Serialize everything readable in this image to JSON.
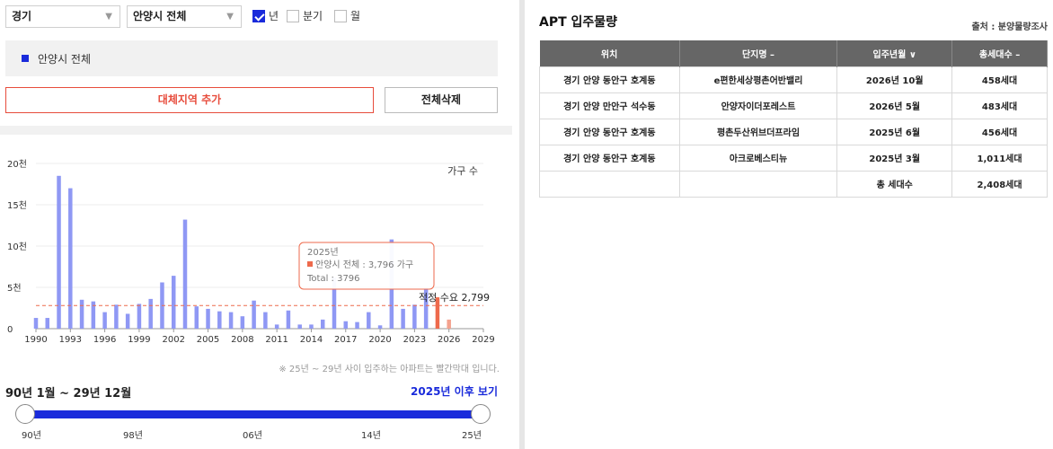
{
  "filters": {
    "province": "경기",
    "city": "안양시 전체",
    "dropdown_arrow": "▼",
    "period_options": [
      {
        "label": "년",
        "checked": true
      },
      {
        "label": "분기",
        "checked": false
      },
      {
        "label": "월",
        "checked": false
      }
    ]
  },
  "selected_region": "안양시 전체",
  "buttons": {
    "add_region": "대체지역 추가",
    "delete_all": "전체삭제"
  },
  "chart_data": {
    "type": "bar",
    "unit_label": "가구 수",
    "y_ticks": [
      "0",
      "5천",
      "10천",
      "15천",
      "20천"
    ],
    "ylim": [
      0,
      20000
    ],
    "x_ticks": [
      "1990",
      "1993",
      "1996",
      "1999",
      "2002",
      "2005",
      "2008",
      "2011",
      "2014",
      "2017",
      "2020",
      "2023",
      "2026",
      "2029"
    ],
    "x_range": [
      1990,
      2029
    ],
    "series": [
      {
        "color_past": "#8f98f4",
        "color_future": "#f4a28e",
        "color_highlight": "#ee6a4c",
        "points": [
          {
            "year": 1990,
            "value": 1300
          },
          {
            "year": 1991,
            "value": 1300
          },
          {
            "year": 1992,
            "value": 18500
          },
          {
            "year": 1993,
            "value": 17000
          },
          {
            "year": 1994,
            "value": 3500
          },
          {
            "year": 1995,
            "value": 3300
          },
          {
            "year": 1996,
            "value": 2000
          },
          {
            "year": 1997,
            "value": 2900
          },
          {
            "year": 1998,
            "value": 1800
          },
          {
            "year": 1999,
            "value": 3000
          },
          {
            "year": 2000,
            "value": 3600
          },
          {
            "year": 2001,
            "value": 5600
          },
          {
            "year": 2002,
            "value": 6400
          },
          {
            "year": 2003,
            "value": 13200
          },
          {
            "year": 2004,
            "value": 2700
          },
          {
            "year": 2005,
            "value": 2400
          },
          {
            "year": 2006,
            "value": 2100
          },
          {
            "year": 2007,
            "value": 2000
          },
          {
            "year": 2008,
            "value": 1500
          },
          {
            "year": 2009,
            "value": 3400
          },
          {
            "year": 2010,
            "value": 2000
          },
          {
            "year": 2011,
            "value": 500
          },
          {
            "year": 2012,
            "value": 2200
          },
          {
            "year": 2013,
            "value": 500
          },
          {
            "year": 2014,
            "value": 500
          },
          {
            "year": 2015,
            "value": 1100
          },
          {
            "year": 2016,
            "value": 6200
          },
          {
            "year": 2017,
            "value": 900
          },
          {
            "year": 2018,
            "value": 800
          },
          {
            "year": 2019,
            "value": 2000
          },
          {
            "year": 2020,
            "value": 400
          },
          {
            "year": 2021,
            "value": 10800
          },
          {
            "year": 2022,
            "value": 2400
          },
          {
            "year": 2023,
            "value": 2900
          },
          {
            "year": 2024,
            "value": 5000
          },
          {
            "year": 2025,
            "value": 3796
          },
          {
            "year": 2026,
            "value": 1100
          }
        ]
      }
    ],
    "reference_line": {
      "label": "적정 수요 2,799",
      "value": 2799,
      "color": "#ee6a4c"
    },
    "tooltip": {
      "year_label": "2025년",
      "series_line": "안양시 전체 : 3,796 가구",
      "total_line": "Total : 3796",
      "year": 2025
    }
  },
  "chart_note": "※ 25년 ~ 29년 사이 입주하는 아파트는 빨간막대 입니다.",
  "period_label": "90년 1월 ~ 29년 12월",
  "show_after_2025": "2025년 이후 보기",
  "slider": {
    "tick_labels": [
      "90년",
      "98년",
      "06년",
      "14년",
      "25년"
    ],
    "range_start": "90년",
    "range_end": "25년"
  },
  "apt_panel": {
    "title": "APT 입주물량",
    "source": "출처 : 분양물량조사",
    "columns": [
      "위치",
      "단지명 –",
      "입주년월 ∨",
      "총세대수 –"
    ],
    "rows": [
      [
        "경기 안양 동안구 호계동",
        "e편한세상평촌어반밸리",
        "2026년 10월",
        "458세대"
      ],
      [
        "경기 안양 만안구 석수동",
        "안양자이더포레스트",
        "2026년 5월",
        "483세대"
      ],
      [
        "경기 안양 동안구 호계동",
        "평촌두산위브더프라임",
        "2025년 6월",
        "456세대"
      ],
      [
        "경기 안양 동안구 호계동",
        "아크로베스티뉴",
        "2025년 3월",
        "1,011세대"
      ]
    ],
    "total_label": "총 세대수",
    "total_value": "2,408세대"
  }
}
